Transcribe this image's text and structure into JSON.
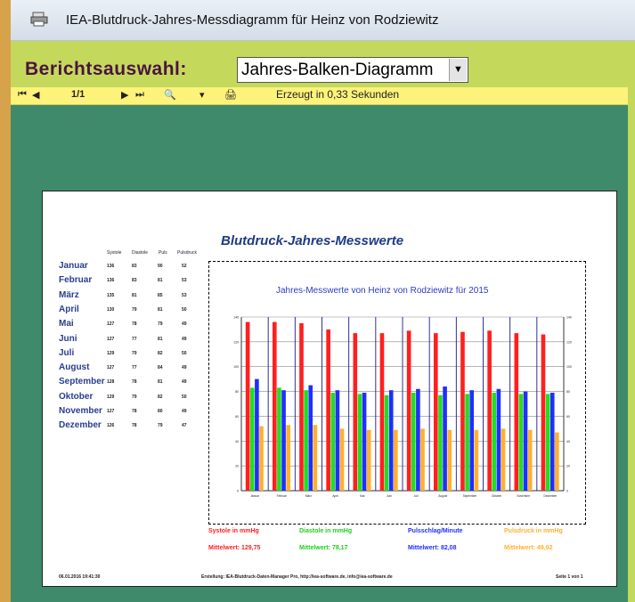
{
  "window": {
    "title": "IEA-Blutdruck-Jahres-Messdiagramm für Heinz von Rodziewitz"
  },
  "selector": {
    "label": "Berichtsauswahl:",
    "value": "Jahres-Balken-Diagramm"
  },
  "toolbar": {
    "first": "⏮",
    "prev": "◀",
    "page": "1/1",
    "next": "▶",
    "last": "⏭",
    "search": "🔍",
    "dropdown": "▾",
    "print": "🖨",
    "status": "Erzeugt in 0,33 Sekunden"
  },
  "report": {
    "title": "Blutdruck-Jahres-Messwerte",
    "table_headers": [
      "Systole",
      "Diastole",
      "Puls",
      "Pulsdruck"
    ],
    "months": [
      {
        "name": "Januar",
        "sys": "136",
        "dia": "83",
        "pul": "90",
        "pd": "52"
      },
      {
        "name": "Februar",
        "sys": "136",
        "dia": "83",
        "pul": "81",
        "pd": "53"
      },
      {
        "name": "März",
        "sys": "135",
        "dia": "81",
        "pul": "85",
        "pd": "53"
      },
      {
        "name": "April",
        "sys": "130",
        "dia": "79",
        "pul": "81",
        "pd": "50"
      },
      {
        "name": "Mai",
        "sys": "127",
        "dia": "78",
        "pul": "79",
        "pd": "49"
      },
      {
        "name": "Juni",
        "sys": "127",
        "dia": "77",
        "pul": "81",
        "pd": "49"
      },
      {
        "name": "Juli",
        "sys": "129",
        "dia": "79",
        "pul": "82",
        "pd": "50"
      },
      {
        "name": "August",
        "sys": "127",
        "dia": "77",
        "pul": "84",
        "pd": "49"
      },
      {
        "name": "September",
        "sys": "128",
        "dia": "78",
        "pul": "81",
        "pd": "49"
      },
      {
        "name": "Oktober",
        "sys": "129",
        "dia": "79",
        "pul": "82",
        "pd": "50"
      },
      {
        "name": "November",
        "sys": "127",
        "dia": "78",
        "pul": "80",
        "pd": "49"
      },
      {
        "name": "Dezember",
        "sys": "126",
        "dia": "78",
        "pul": "79",
        "pd": "47"
      }
    ],
    "legend": [
      {
        "label": "Systole in mmHg",
        "color": "#ff1f1f"
      },
      {
        "label": "Diastole in mmHg",
        "color": "#22dd22"
      },
      {
        "label": "Pulsschlag/Minute",
        "color": "#1f2fff"
      },
      {
        "label": "Pulsdruck in mmHg",
        "color": "#ffb030"
      }
    ],
    "means": [
      {
        "label": "Mittelwert: 129,75",
        "color": "#ff1f1f"
      },
      {
        "label": "Mittelwert: 78,17",
        "color": "#22cc22"
      },
      {
        "label": "Mittelwert: 82,08",
        "color": "#1f2fff"
      },
      {
        "label": "Mittelwert: 49,92",
        "color": "#ffb030"
      }
    ],
    "footer_date": "06.01.2016 19:41:30",
    "footer_credit": "Erstellung: IEA-Blutdruck-Daten-Manager Pro, http://iea-software.de, info@iea-software.de",
    "footer_page": "Seite 1 von 1"
  },
  "chart_data": {
    "type": "bar",
    "title": "Jahres-Messwerte von Heinz von Rodziewitz für 2015",
    "categories": [
      "Januar",
      "Februar",
      "März",
      "April",
      "Mai",
      "Juni",
      "Juli",
      "August",
      "September",
      "Oktober",
      "November",
      "Dezember"
    ],
    "series": [
      {
        "name": "Systole in mmHg",
        "color": "#ff1f1f",
        "values": [
          136,
          136,
          135,
          130,
          127,
          127,
          129,
          127,
          128,
          129,
          127,
          126
        ]
      },
      {
        "name": "Diastole in mmHg",
        "color": "#22dd22",
        "values": [
          83,
          83,
          81,
          79,
          78,
          77,
          79,
          77,
          78,
          79,
          78,
          78
        ]
      },
      {
        "name": "Pulsschlag/Minute",
        "color": "#1f2fff",
        "values": [
          90,
          81,
          85,
          81,
          79,
          81,
          82,
          84,
          81,
          82,
          80,
          79
        ]
      },
      {
        "name": "Pulsdruck in mmHg",
        "color": "#ffb030",
        "values": [
          52,
          53,
          53,
          50,
          49,
          49,
          50,
          49,
          49,
          50,
          49,
          47
        ]
      }
    ],
    "ylim": [
      0,
      140
    ],
    "yticks": [
      "0",
      "20",
      "40",
      "60",
      "80",
      "100",
      "120",
      "140"
    ],
    "grid": true
  }
}
